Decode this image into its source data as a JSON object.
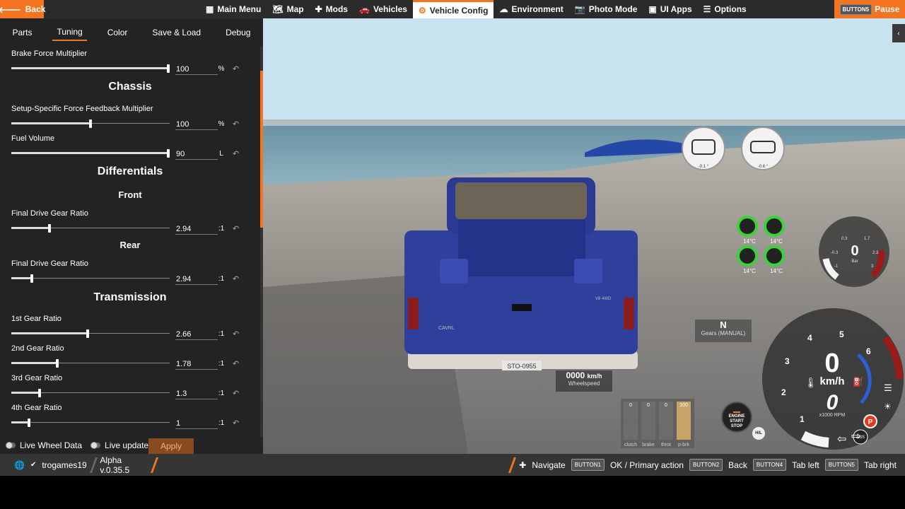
{
  "topbar": {
    "back_label": "Back",
    "menu": [
      {
        "label": "Main Menu",
        "icon": "grid-icon"
      },
      {
        "label": "Map",
        "icon": "map-icon"
      },
      {
        "label": "Mods",
        "icon": "puzzle-icon"
      },
      {
        "label": "Vehicles",
        "icon": "car-icon"
      },
      {
        "label": "Vehicle Config",
        "icon": "engine-icon"
      },
      {
        "label": "Environment",
        "icon": "weather-icon"
      },
      {
        "label": "Photo Mode",
        "icon": "camera-icon"
      },
      {
        "label": "UI Apps",
        "icon": "apps-icon"
      },
      {
        "label": "Options",
        "icon": "sliders-icon"
      }
    ],
    "pause_key": "BUTTON5",
    "pause_label": "Pause"
  },
  "tabs": [
    "Parts",
    "Tuning",
    "Color",
    "Save & Load",
    "Debug"
  ],
  "active_tab": "Tuning",
  "tuning": {
    "brake": {
      "label": "Brake Force Multiplier",
      "value": "100",
      "unit": "%",
      "fraction": 0.99
    },
    "chassis_title": "Chassis",
    "ffb": {
      "label": "Setup-Specific Force Feedback Multiplier",
      "value": "100",
      "unit": "%",
      "fraction": 0.5
    },
    "fuel": {
      "label": "Fuel Volume",
      "value": "90",
      "unit": "L",
      "fraction": 0.99
    },
    "diff_title": "Differentials",
    "front_title": "Front",
    "front_ratio": {
      "label": "Final Drive Gear Ratio",
      "value": "2.94",
      "unit": ":1",
      "fraction": 0.24
    },
    "rear_title": "Rear",
    "rear_ratio": {
      "label": "Final Drive Gear Ratio",
      "value": "2.94",
      "unit": ":1",
      "fraction": 0.13
    },
    "trans_title": "Transmission",
    "gear1": {
      "label": "1st Gear Ratio",
      "value": "2.66",
      "unit": ":1",
      "fraction": 0.48
    },
    "gear2": {
      "label": "2nd Gear Ratio",
      "value": "1.78",
      "unit": ":1",
      "fraction": 0.29
    },
    "gear3": {
      "label": "3rd Gear Ratio",
      "value": "1.3",
      "unit": ":1",
      "fraction": 0.18
    },
    "gear4": {
      "label": "4th Gear Ratio",
      "value": "1",
      "unit": ":1",
      "fraction": 0.11
    }
  },
  "panel_bottom": {
    "live_wheel": "Live Wheel Data",
    "live_updates": "Live updates",
    "apply": "Apply"
  },
  "hud": {
    "speed_value": "0000",
    "speed_unit": "km/h",
    "speed_label": "Wheelspeed",
    "gear": "N",
    "gear_mode": "Gears (MANUAL)",
    "pedals": [
      {
        "label": "clutch",
        "value": "0"
      },
      {
        "label": "brake",
        "value": "0"
      },
      {
        "label": "throt",
        "value": "0"
      },
      {
        "label": "p-brk",
        "value": "100"
      }
    ],
    "start_stop": [
      "ENGINE",
      "START",
      "STOP"
    ],
    "hi_label": "H/L",
    "tire_temps": [
      "14°C",
      "14°C",
      "14°C",
      "14°C"
    ],
    "tilt_left": "-0.1 °",
    "tilt_right": "-0.6 °",
    "boost_value": "0",
    "boost_unit": "Bar",
    "boost_ticks": [
      "0.3",
      "1.7",
      "-0.3",
      "2.3",
      "-1",
      "3"
    ],
    "speedo_value": "0",
    "speedo_unit": "km/h",
    "rpm_value": "0",
    "rpm_unit": "x1000 RPM",
    "rpm_ticks": [
      "1",
      "2",
      "3",
      "4",
      "5",
      "6"
    ],
    "abs_label": "ABS",
    "park_label": "P",
    "plate": "STO-0955",
    "badge": "CAVRL",
    "trim_badge": "V8 4WD"
  },
  "bottombar": {
    "username": "trogames19",
    "version": "Alpha v.0.35.5",
    "hints": [
      {
        "label": "Navigate",
        "key": ""
      },
      {
        "label": "OK / Primary action",
        "key": "BUTTON1"
      },
      {
        "label": "Back",
        "key": "BUTTON2"
      },
      {
        "label": "Tab left",
        "key": "BUTTON4"
      },
      {
        "label": "Tab right",
        "key": "BUTTON5"
      }
    ]
  },
  "colors": {
    "accent": "#f47421",
    "panel": "#222325",
    "truck": "#2e3f9c"
  }
}
